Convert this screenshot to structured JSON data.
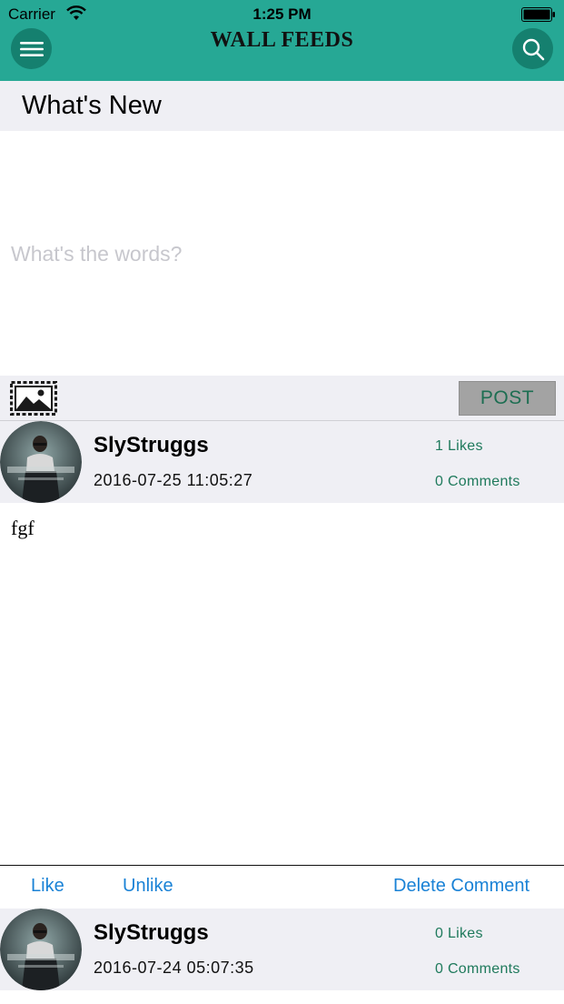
{
  "status_bar": {
    "carrier": "Carrier",
    "time": "1:25 PM"
  },
  "header": {
    "title": "WALL FEEDS",
    "menu_icon": "hamburger-menu-icon",
    "search_icon": "search-icon",
    "background_color": "#26a895"
  },
  "compose": {
    "heading": "What's New",
    "placeholder": "What's the words?",
    "image_icon": "image-picker-icon",
    "post_label": "POST"
  },
  "feed": [
    {
      "username": "SlyStruggs",
      "timestamp": "2016-07-25 11:05:27",
      "likes": "1 Likes",
      "comments": "0 Comments",
      "text": "fgf",
      "actions": {
        "like": "Like",
        "unlike": "Unlike",
        "delete_comment": "Delete Comment"
      }
    },
    {
      "username": "SlyStruggs",
      "timestamp": "2016-07-24 05:07:35",
      "likes": "0 Likes",
      "comments": "0 Comments"
    }
  ],
  "colors": {
    "accent": "#26a895",
    "link": "#1a82d6",
    "counts": "#1f7a5c"
  }
}
